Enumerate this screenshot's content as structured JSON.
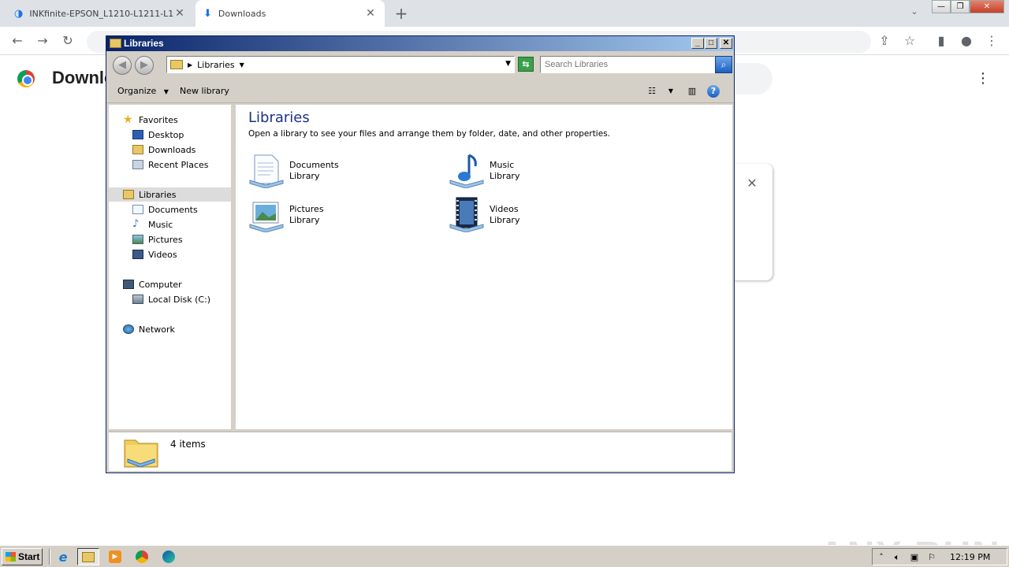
{
  "browser": {
    "tabs": [
      {
        "title": "INKfinite-EPSON_L1210-L1211-L121",
        "active": false
      },
      {
        "title": "Downloads",
        "active": true
      }
    ],
    "page_title": "Downlo",
    "watermark": "ANY RUN"
  },
  "explorer": {
    "window_title": "Libraries",
    "address": {
      "path": "Libraries"
    },
    "search_placeholder": "Search Libraries",
    "commands": {
      "organize": "Organize",
      "new_library": "New library"
    },
    "nav": {
      "favorites": "Favorites",
      "desktop": "Desktop",
      "downloads": "Downloads",
      "recent_places": "Recent Places",
      "libraries": "Libraries",
      "documents": "Documents",
      "music": "Music",
      "pictures": "Pictures",
      "videos": "Videos",
      "computer": "Computer",
      "local_disk": "Local Disk (C:)",
      "network": "Network"
    },
    "main": {
      "title": "Libraries",
      "subtitle": "Open a library to see your files and arrange them by folder, date, and other properties.",
      "libraries": [
        {
          "name": "Documents",
          "type": "Library",
          "icon": "documents-library-icon"
        },
        {
          "name": "Music",
          "type": "Library",
          "icon": "music-library-icon"
        },
        {
          "name": "Pictures",
          "type": "Library",
          "icon": "pictures-library-icon"
        },
        {
          "name": "Videos",
          "type": "Library",
          "icon": "videos-library-icon"
        }
      ]
    },
    "status": {
      "item_count": "4 items"
    }
  },
  "taskbar": {
    "start_label": "Start",
    "clock": "12:19 PM"
  },
  "colors": {
    "title_bar_start": "#0a246a",
    "title_bar_end": "#a6caf0",
    "selected_nav": "#dcdcdc",
    "library_title": "#1e3287"
  }
}
